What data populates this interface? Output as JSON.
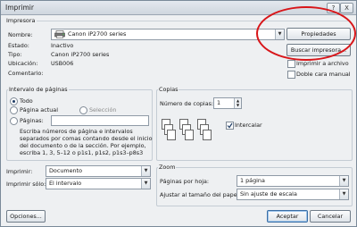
{
  "window": {
    "title": "Imprimir",
    "help": "?",
    "close": "X"
  },
  "printer": {
    "group_title": "Impresora",
    "name_label": "Nombre:",
    "name_value": "Canon iP2700 series",
    "status_label": "Estado:",
    "status_value": "Inactivo",
    "type_label": "Tipo:",
    "type_value": "Canon iP2700 series",
    "location_label": "Ubicación:",
    "location_value": "USB006",
    "comment_label": "Comentario:",
    "properties_button": "Propiedades",
    "find_button": "Buscar impresora...",
    "print_to_file": "Imprimir a archivo",
    "manual_duplex": "Doble cara manual"
  },
  "range": {
    "group_title": "Intervalo de páginas",
    "all": "Todo",
    "current": "Página actual",
    "selection": "Selección",
    "pages": "Páginas:",
    "hint_1": "Escriba números de página e intervalos",
    "hint_2": "separados por comas contando desde el inicio",
    "hint_3": "del documento o de la sección. Por ejemplo,",
    "hint_4": "escriba 1, 3, 5–12 o p1s1, p1s2, p1s3–p8s3"
  },
  "copies": {
    "group_title": "Copias",
    "count_label": "Número de copias:",
    "count_value": "1",
    "collate": "Intercalar"
  },
  "print_what": {
    "label": "Imprimir:",
    "value": "Documento"
  },
  "print_only": {
    "label": "Imprimir sólo:",
    "value": "El intervalo"
  },
  "zoom": {
    "group_title": "Zoom",
    "pages_per_sheet_label": "Páginas por hoja:",
    "pages_per_sheet_value": "1 página",
    "scale_label": "Ajustar al tamaño del papel:",
    "scale_value": "Sin ajuste de escala"
  },
  "buttons": {
    "options": "Opciones...",
    "ok": "Aceptar",
    "cancel": "Cancelar"
  },
  "icons": {
    "printer": "printer-icon",
    "annotation": "red-ellipse"
  },
  "colors": {
    "annotation": "#d8161a",
    "checkbox_check": "#1f3d66"
  }
}
